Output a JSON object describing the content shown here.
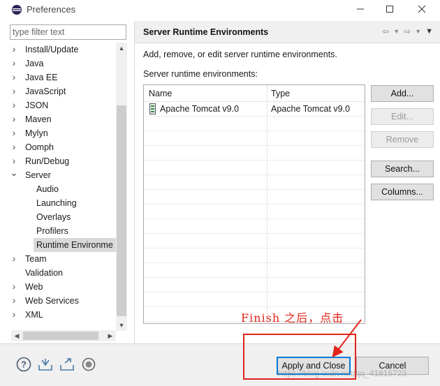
{
  "window": {
    "title": "Preferences"
  },
  "left": {
    "filter_placeholder": "type filter text",
    "tree": [
      {
        "label": "Install/Update",
        "twisty": "›"
      },
      {
        "label": "Java",
        "twisty": "›"
      },
      {
        "label": "Java EE",
        "twisty": "›"
      },
      {
        "label": "JavaScript",
        "twisty": "›"
      },
      {
        "label": "JSON",
        "twisty": "›"
      },
      {
        "label": "Maven",
        "twisty": "›"
      },
      {
        "label": "Mylyn",
        "twisty": "›"
      },
      {
        "label": "Oomph",
        "twisty": "›"
      },
      {
        "label": "Run/Debug",
        "twisty": "›"
      },
      {
        "label": "Server",
        "twisty": "⌄"
      },
      {
        "label": "Audio"
      },
      {
        "label": "Launching"
      },
      {
        "label": "Overlays"
      },
      {
        "label": "Profilers"
      },
      {
        "label": "Runtime Environme"
      },
      {
        "label": "Team",
        "twisty": "›"
      },
      {
        "label": "Validation"
      },
      {
        "label": "Web",
        "twisty": "›"
      },
      {
        "label": "Web Services",
        "twisty": "›"
      },
      {
        "label": "XML",
        "twisty": "›"
      }
    ]
  },
  "right": {
    "page_title": "Server Runtime Environments",
    "description": "Add, remove, or edit server runtime environments.",
    "table_label": "Server runtime environments:",
    "columns": [
      "Name",
      "Type"
    ],
    "rows": [
      {
        "name": "Apache Tomcat v9.0",
        "type": "Apache Tomcat v9.0"
      }
    ],
    "buttons": {
      "add": "Add...",
      "edit": "Edit...",
      "remove": "Remove",
      "search": "Search...",
      "columns": "Columns..."
    }
  },
  "footer": {
    "apply_close": "Apply and Close",
    "cancel": "Cancel"
  },
  "annotation": {
    "text": "Finish 之后，点击",
    "color": "#e0241b"
  },
  "watermark": "https://blog.csdn.net/qq_41815723"
}
